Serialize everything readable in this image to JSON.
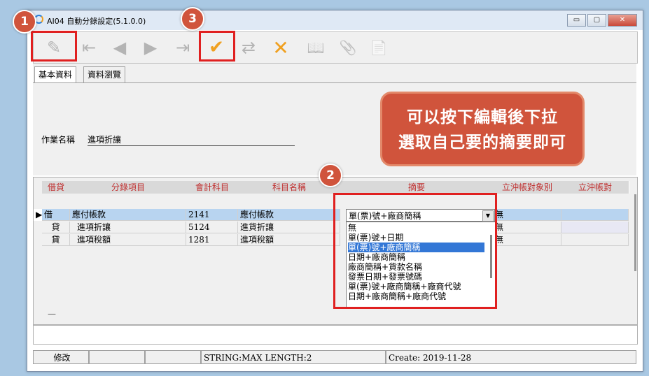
{
  "window": {
    "title": "AI04 自動分錄設定(5.1.0.0)",
    "min_label": "▭",
    "max_label": "▢",
    "close_label": "✕"
  },
  "toolbar": {
    "buttons": [
      {
        "icon": "pencil-icon",
        "glyph": "✎"
      },
      {
        "icon": "first-icon",
        "glyph": "⇤"
      },
      {
        "icon": "prev-icon",
        "glyph": "◀"
      },
      {
        "icon": "next-icon",
        "glyph": "▶"
      },
      {
        "icon": "last-icon",
        "glyph": "⇥"
      },
      {
        "icon": "confirm-icon",
        "glyph": "✔"
      },
      {
        "icon": "refresh-icon",
        "glyph": "⇄"
      },
      {
        "icon": "cancel-icon",
        "glyph": "✕"
      },
      {
        "icon": "book-icon",
        "glyph": "📖"
      },
      {
        "icon": "attach-icon",
        "glyph": "📎"
      },
      {
        "icon": "xls-icon",
        "glyph": "📄"
      }
    ]
  },
  "tabs": [
    "基本資料",
    "資料瀏覽"
  ],
  "form": {
    "label": "作業名稱",
    "value": "進項折讓"
  },
  "grid": {
    "headers": [
      "借貸",
      "分錄項目",
      "會計科目",
      "科目名稱",
      "摘要",
      "立沖帳對象別",
      "立沖帳對"
    ],
    "rows": [
      {
        "indicator": "▶",
        "dc": "借",
        "item": "應付帳款",
        "acct": "2141",
        "name": "應付帳款",
        "summary": "單(票)號+廠商簡稱",
        "target": "無"
      },
      {
        "indicator": "",
        "dc": "貸",
        "item": "進項折讓",
        "acct": "5124",
        "name": "進貨折讓",
        "summary": "",
        "target": "無"
      },
      {
        "indicator": "",
        "dc": "貸",
        "item": "進項稅額",
        "acct": "1281",
        "name": "進項稅額",
        "summary": "",
        "target": "無"
      }
    ],
    "dropdown": {
      "selected": "單(票)號+廠商簡稱",
      "options": [
        "無",
        "單(票)號+日期",
        "單(票)號+廠商簡稱",
        "日期+廠商簡稱",
        "廠商簡稱+貨款名稱",
        "發票日期+發票號碼",
        "單(票)號+廠商簡稱+廠商代號",
        "日期+廠商簡稱+廠商代號"
      ],
      "highlighted_index": 2
    },
    "footer_dash": "—"
  },
  "status": {
    "mode": "修改",
    "info": "STRING:MAX LENGTH:2",
    "create": "Create:  2019-11-28"
  },
  "callout": {
    "line1": "可以按下編輯後下拉",
    "line2": "選取自己要的摘要即可"
  },
  "badges": [
    "1",
    "2",
    "3"
  ],
  "colors": {
    "accent": "#d0543c",
    "highlight": "#b8d4f0",
    "header_text": "#c03030"
  }
}
